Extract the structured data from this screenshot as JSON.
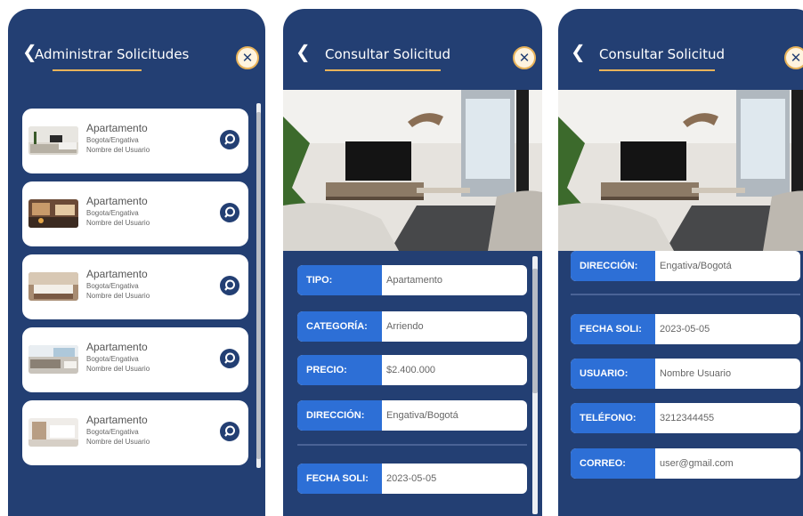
{
  "caption_fragment": "",
  "screens": [
    {
      "title": "Administrar Solicitudes",
      "back_glyph": "❮",
      "close_glyph": "✕",
      "items": [
        {
          "type": "Apartamento",
          "location": "Bogota/Engativa",
          "user": "Nombre del Usuario",
          "thumb": "living-room"
        },
        {
          "type": "Apartamento",
          "location": "Bogota/Engativa",
          "user": "Nombre del Usuario",
          "thumb": "kitchen"
        },
        {
          "type": "Apartamento",
          "location": "Bogota/Engativa",
          "user": "Nombre del Usuario",
          "thumb": "bedroom"
        },
        {
          "type": "Apartamento",
          "location": "Bogota/Engativa",
          "user": "Nombre del Usuario",
          "thumb": "lounge"
        },
        {
          "type": "Apartamento",
          "location": "Bogota/Engativa",
          "user": "Nombre del Usuario",
          "thumb": "bright-room"
        }
      ]
    },
    {
      "title": "Consultar Solicitud",
      "back_glyph": "❮",
      "close_glyph": "✕",
      "fields": [
        {
          "label": "TIPO:",
          "value": "Apartamento"
        },
        {
          "label": "CATEGORÍA:",
          "value": "Arriendo"
        },
        {
          "label": "PRECIO:",
          "value": "$2.400.000"
        },
        {
          "label": "DIRECCIÓN:",
          "value": "Engativa/Bogotá"
        },
        {
          "label": "FECHA SOLI:",
          "value": "2023-05-05"
        }
      ]
    },
    {
      "title": "Consultar Solicitud",
      "back_glyph": "❮",
      "close_glyph": "✕",
      "fields": [
        {
          "label": "DIRECCIÓN:",
          "value": "Engativa/Bogotá"
        },
        {
          "label": "FECHA SOLI:",
          "value": "2023-05-05"
        },
        {
          "label": "USUARIO:",
          "value": "Nombre Usuario"
        },
        {
          "label": "TELÉFONO:",
          "value": "3212344455"
        },
        {
          "label": "CORREO:",
          "value": "user@gmail.com"
        }
      ]
    }
  ],
  "colors": {
    "screen_bg": "#233f73",
    "accent_gold": "#e8b35a",
    "label_blue": "#2d6fd6"
  },
  "icons": [
    "back-chevron-icon",
    "close-icon",
    "search-icon"
  ]
}
